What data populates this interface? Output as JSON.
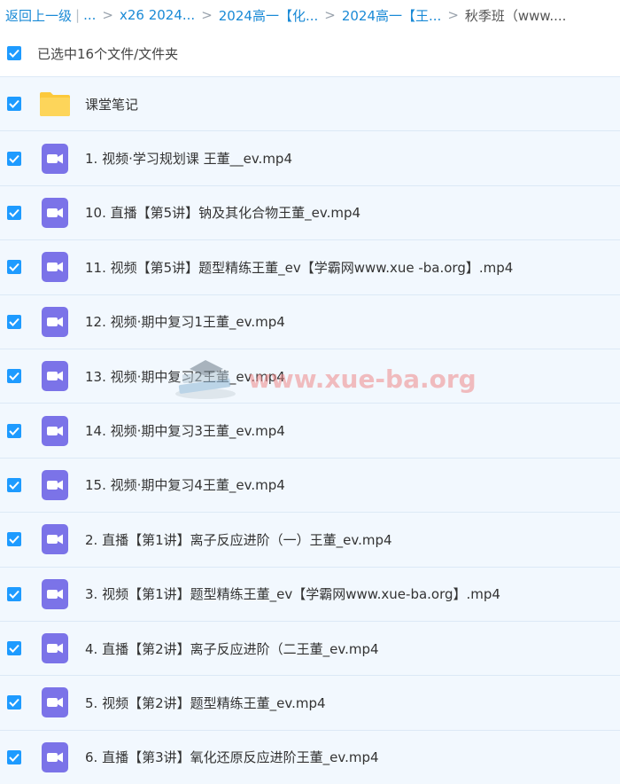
{
  "breadcrumb": {
    "back": "返回上一级",
    "ellipsis": "...",
    "items": [
      "x26 2024...",
      "2024高一【化...",
      "2024高一【王..."
    ],
    "current": "秋季班（www...."
  },
  "selection": {
    "text": "已选中16个文件/文件夹"
  },
  "files": [
    {
      "name": "课堂笔记",
      "type": "folder"
    },
    {
      "name": "1. 视频·学习规划课 王董__ev.mp4",
      "type": "video"
    },
    {
      "name": "10. 直播【第5讲】钠及其化合物王董_ev.mp4",
      "type": "video"
    },
    {
      "name": "11. 视频【第5讲】题型精练王董_ev【学霸网www.xue -ba.org】.mp4",
      "type": "video"
    },
    {
      "name": "12. 视频·期中复习1王董_ev.mp4",
      "type": "video"
    },
    {
      "name": "13. 视频·期中复习2王董_ev.mp4",
      "type": "video"
    },
    {
      "name": "14. 视频·期中复习3王董_ev.mp4",
      "type": "video"
    },
    {
      "name": "15. 视频·期中复习4王董_ev.mp4",
      "type": "video"
    },
    {
      "name": "2. 直播【第1讲】离子反应进阶（一）王董_ev.mp4",
      "type": "video"
    },
    {
      "name": "3. 视频【第1讲】题型精练王董_ev【学霸网www.xue-ba.org】.mp4",
      "type": "video"
    },
    {
      "name": "4. 直播【第2讲】离子反应进阶（二王董_ev.mp4",
      "type": "video"
    },
    {
      "name": "5. 视频【第2讲】题型精练王董_ev.mp4",
      "type": "video"
    },
    {
      "name": "6. 直播【第3讲】氧化还原反应进阶王董_ev.mp4",
      "type": "video"
    }
  ],
  "watermark": {
    "text": "www.xue-ba.org"
  },
  "colors": {
    "link": "#1a8ad6",
    "checkbox": "#1e9bff",
    "row_bg": "#f2f8fe",
    "video_icon": "#7b73e8",
    "folder_icon": "#fcc93b"
  }
}
